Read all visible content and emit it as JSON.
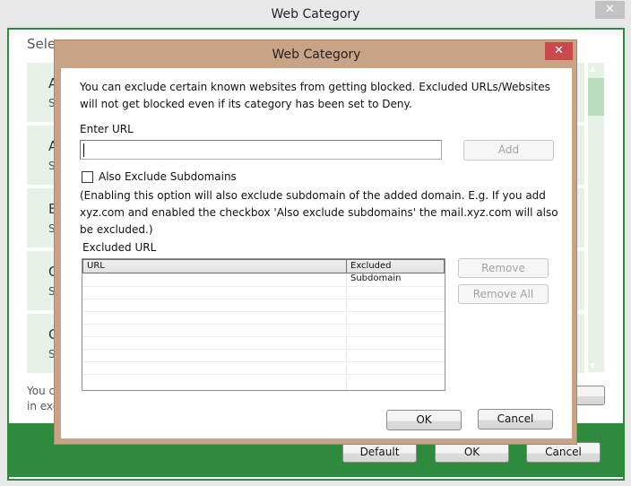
{
  "window": {
    "title": "Web Category",
    "close_icon": "close-icon"
  },
  "background": {
    "select_text": "Sele",
    "rows": [
      {
        "a": "A",
        "s": "S"
      },
      {
        "a": "A",
        "s": "S"
      },
      {
        "a": "E",
        "s": "S"
      },
      {
        "a": "C",
        "s": "S"
      },
      {
        "a": "C",
        "s": "S"
      }
    ],
    "note_line1": "You c",
    "note_line2": "in exc",
    "buttons": {
      "default": "Default",
      "ok": "OK",
      "cancel": "Cancel"
    }
  },
  "dialog": {
    "title": "Web Category",
    "description": "You can exclude certain known websites from getting blocked. Excluded URLs/Websites will not get blocked even if its category has been set to Deny.",
    "enter_url_label": "Enter URL",
    "url_value": "",
    "add_label": "Add",
    "checkbox_label": "Also Exclude Subdomains",
    "checkbox_checked": false,
    "hint": "(Enabling this option will also exclude subdomain of the added domain. E.g. If you add xyz.com and enabled the checkbox 'Also exclude subdomains' the mail.xyz.com will also be excluded.)",
    "excluded_label": "Excluded URL",
    "columns": [
      "URL",
      "Excluded Subdomain"
    ],
    "rows": [],
    "remove_label": "Remove",
    "remove_all_label": "Remove All",
    "ok_label": "OK",
    "cancel_label": "Cancel"
  },
  "colors": {
    "accent_green": "#2e8b3e",
    "dialog_border": "#c9a386",
    "close_red": "#c9494c"
  }
}
